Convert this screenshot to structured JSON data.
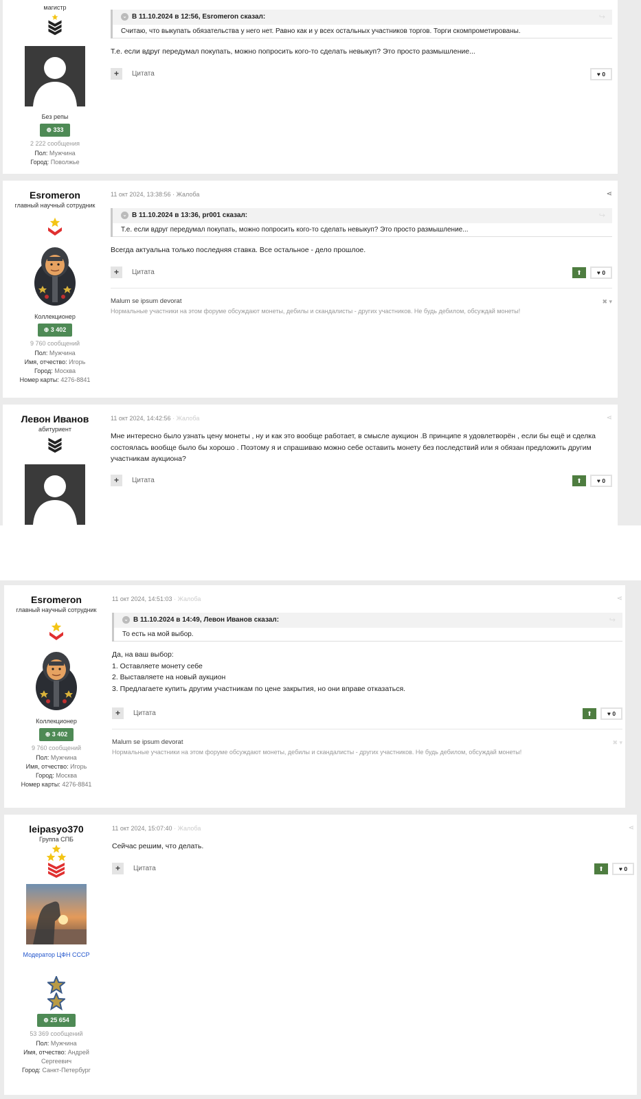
{
  "colors": {
    "reputation": "#4e8a55",
    "upvote": "#4e7d40",
    "moderator_link": "#2255cc",
    "rank_star": "#f3c415"
  },
  "posts": [
    {
      "author": {
        "title": "магистр",
        "group": "Без репы",
        "reputation": "333",
        "posts_count": "2 222 сообщения",
        "fields": [
          {
            "label": "Пол:",
            "value": "Мужчина"
          },
          {
            "label": "Город:",
            "value": "Поволжье"
          }
        ]
      },
      "quote": {
        "header": "В 11.10.2024 в 12:56, Esromeron сказал:",
        "text": "Считаю, что выкупать обязательства у него нет. Равно как и у всех остальных участников торгов. Торги скомпрометированы."
      },
      "text": "Т.е. если вдруг передумал покупать, можно попросить кого-то сделать невыкуп? Это просто размышление...",
      "cite_label": "Цитата",
      "likes": "0"
    },
    {
      "author": {
        "name": "Esromeron",
        "title": "главный научный сотрудник",
        "group": "Коллекционер",
        "reputation": "3 402",
        "posts_count": "9 760 сообщений",
        "fields": [
          {
            "label": "Пол:",
            "value": "Мужчина"
          },
          {
            "label": "Имя, отчество:",
            "value": "Игорь"
          },
          {
            "label": "Город:",
            "value": "Москва"
          },
          {
            "label": "Номер карты:",
            "value": "4276-8841"
          }
        ]
      },
      "date": "11 окт 2024, 13:38:56",
      "report": "Жалоба",
      "quote": {
        "header": "В 11.10.2024 в 13:36, pr001 сказал:",
        "text": "Т.е. если вдруг передумал покупать, можно попросить кого-то сделать невыкуп? Это просто размышление..."
      },
      "text": "Всегда актуальна только последняя ставка. Все остальное - дело прошлое.",
      "cite_label": "Цитата",
      "likes": "0",
      "signature": {
        "title": "Malum se ipsum devorat",
        "text": "Нормальные участники на этом форуме обсуждают монеты, дебилы и скандалисты - других участников. Не будь дебилом, обсуждай монеты!"
      }
    },
    {
      "author": {
        "name": "Левон Иванов",
        "title": "абитуриент"
      },
      "date": "11 окт 2024, 14:42:56",
      "report": "Жалоба",
      "text": "Мне интересно было узнать цену монеты , ну и как это вообще работает, в смысле аукцион .В принципе я удовлетворён  , если бы ещё и сделка состоялась вообще было бы хорошо . Поэтому я и спрашиваю можно себе оставить монету без последствий или я обязан предложить другим участникам аукциона?",
      "cite_label": "Цитата",
      "likes": "0"
    },
    {
      "author": {
        "name": "Esromeron",
        "title": "главный научный сотрудник",
        "group": "Коллекционер",
        "reputation": "3 402",
        "posts_count": "9 760 сообщений",
        "fields": [
          {
            "label": "Пол:",
            "value": "Мужчина"
          },
          {
            "label": "Имя, отчество:",
            "value": "Игорь"
          },
          {
            "label": "Город:",
            "value": "Москва"
          },
          {
            "label": "Номер карты:",
            "value": "4276-8841"
          }
        ]
      },
      "date": "11 окт 2024, 14:51:03",
      "report": "Жалоба",
      "quote": {
        "header": "В 11.10.2024 в 14:49, Левон Иванов сказал:",
        "text": "То есть на мой выбор."
      },
      "lines": [
        "Да, на ваш выбор:",
        "1. Оставляете монету себе",
        "2. Выставляете на новый аукцион",
        "3. Предлагаете купить другим участникам по цене закрытия, но они вправе отказаться."
      ],
      "cite_label": "Цитата",
      "likes": "0",
      "signature": {
        "title": "Malum se ipsum devorat",
        "text": "Нормальные участники на этом форуме обсуждают монеты, дебилы и скандалисты - других участников. Не будь дебилом, обсуждай монеты!"
      }
    },
    {
      "author": {
        "name": "leipasyo370",
        "title": "Группа СПБ",
        "group": "Модератор ЦФН СССР",
        "reputation": "25 654",
        "posts_count": "53 369 сообщений",
        "fields": [
          {
            "label": "Пол:",
            "value": "Мужчина"
          },
          {
            "label": "Имя, отчество:",
            "value": "Андрей Сергеевич"
          },
          {
            "label": "Город:",
            "value": "Санкт-Петербург"
          }
        ]
      },
      "date": "11 окт 2024, 15:07:40",
      "report": "Жалоба",
      "text": "Сейчас решим, что делать.",
      "cite_label": "Цитата",
      "likes": "0"
    }
  ]
}
